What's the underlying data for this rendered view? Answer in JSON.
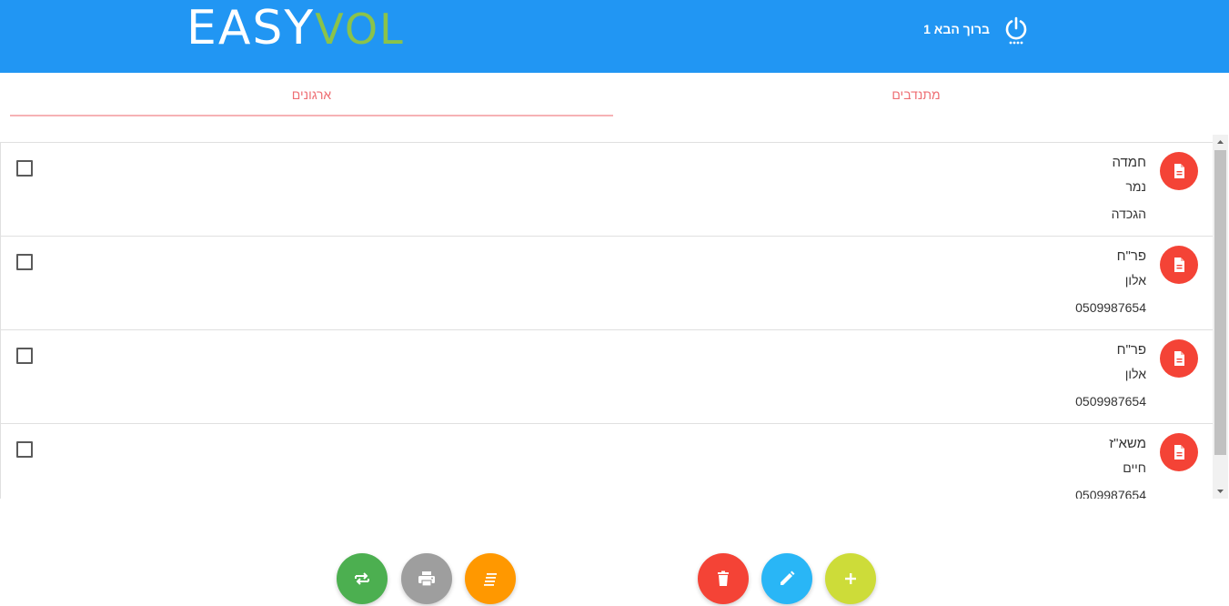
{
  "header": {
    "logo_part1": "EASY",
    "logo_part2": "VOL",
    "welcome_text": "ברוך הבא 1",
    "power_icon": "power-icon",
    "bg_color": "#2196f3"
  },
  "tabs": [
    {
      "label": "ארגונים",
      "active": true
    },
    {
      "label": "מתנדבים",
      "active": false
    }
  ],
  "list": {
    "items": [
      {
        "line1": "חמדה",
        "line2": "נמר",
        "line3": "הגכדה",
        "icon": "document-icon",
        "checked": false
      },
      {
        "line1": "פר\"ח",
        "line2": "אלון",
        "line3": "0509987654",
        "icon": "document-icon",
        "checked": false
      },
      {
        "line1": "פר\"ח",
        "line2": "אלון",
        "line3": "0509987654",
        "icon": "document-icon",
        "checked": false
      },
      {
        "line1": "משא\"ז",
        "line2": "חיים",
        "line3": "0509987654",
        "icon": "document-icon",
        "checked": false
      }
    ]
  },
  "actions": [
    {
      "name": "sync",
      "icon": "swap-icon",
      "color": "#4caf50"
    },
    {
      "name": "print",
      "icon": "print-icon",
      "color": "#9e9e9e"
    },
    {
      "name": "sort",
      "icon": "sort-icon",
      "color": "#ff9800"
    },
    {
      "name": "delete",
      "icon": "trash-icon",
      "color": "#f44336"
    },
    {
      "name": "edit",
      "icon": "pencil-icon",
      "color": "#29b6f6"
    },
    {
      "name": "add",
      "icon": "plus-icon",
      "color": "#cddc39"
    }
  ]
}
